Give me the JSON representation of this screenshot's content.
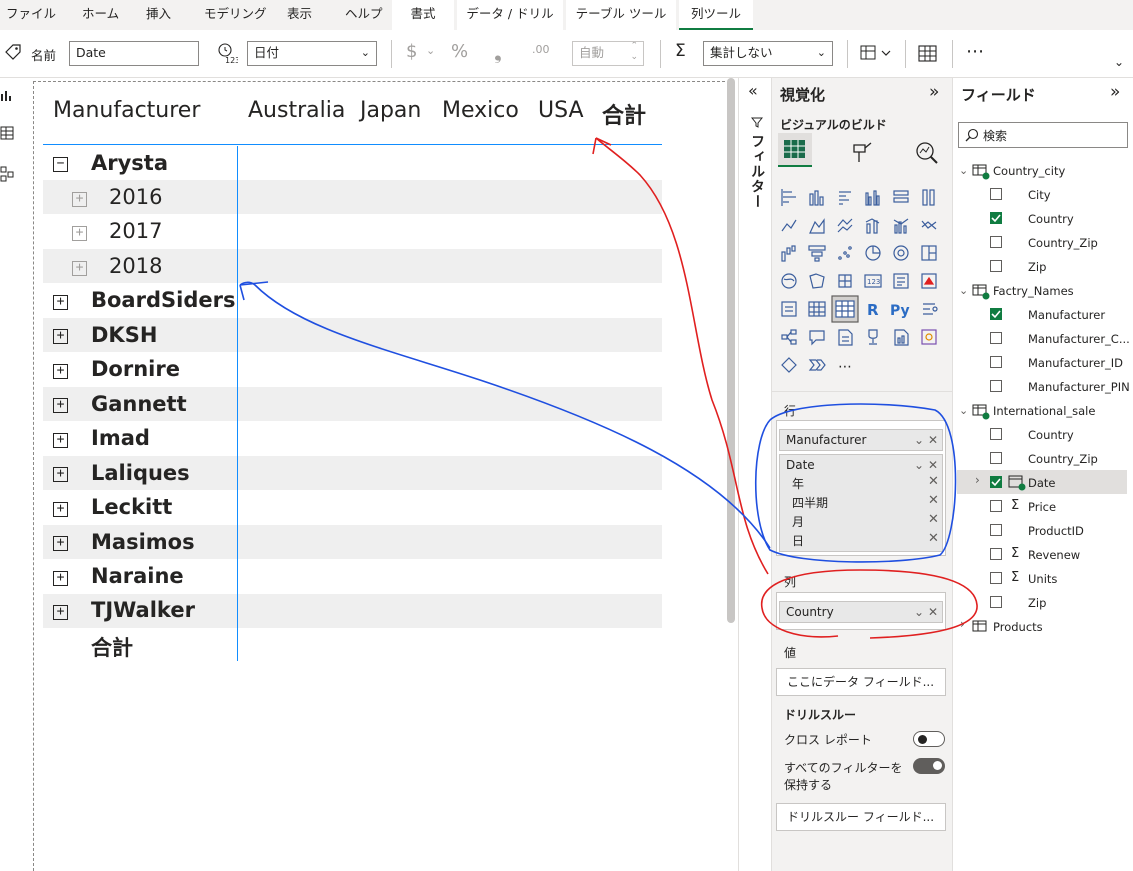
{
  "ribbon": {
    "tabs": [
      "ファイル",
      "ホーム",
      "挿入",
      "モデリング",
      "表示",
      "ヘルプ",
      "書式",
      "データ / ドリル",
      "テーブル ツール",
      "列ツール"
    ],
    "active_tab": "列ツール"
  },
  "toolbar": {
    "name_label": "名前",
    "name_value": "Date",
    "datatype_value": "日付",
    "currency_symbol": "$",
    "percent_symbol": "%",
    "comma_symbol": "❟",
    "decimal_symbol": ".00",
    "auto_value": "自動",
    "sigma": "Σ",
    "summarize_value": "集計しない",
    "more": "⋯"
  },
  "matrix": {
    "row_header": "Manufacturer",
    "columns": [
      "Australia",
      "Japan",
      "Mexico",
      "USA"
    ],
    "total_column": "合計",
    "rows": [
      {
        "label": "Arysta",
        "expander": "−",
        "level": 0
      },
      {
        "label": "2016",
        "expander": "+",
        "level": 1
      },
      {
        "label": "2017",
        "expander": "+",
        "level": 1
      },
      {
        "label": "2018",
        "expander": "+",
        "level": 1
      },
      {
        "label": "BoardSiders",
        "expander": "+",
        "level": 0
      },
      {
        "label": "DKSH",
        "expander": "+",
        "level": 0
      },
      {
        "label": "Dornire",
        "expander": "+",
        "level": 0
      },
      {
        "label": "Gannett",
        "expander": "+",
        "level": 0
      },
      {
        "label": "Imad",
        "expander": "+",
        "level": 0
      },
      {
        "label": "Laliques",
        "expander": "+",
        "level": 0
      },
      {
        "label": "Leckitt",
        "expander": "+",
        "level": 0
      },
      {
        "label": "Masimos",
        "expander": "+",
        "level": 0
      },
      {
        "label": "Naraine",
        "expander": "+",
        "level": 0
      },
      {
        "label": "TJWalker",
        "expander": "+",
        "level": 0
      }
    ],
    "total_row": "合計"
  },
  "filters": {
    "label": "フィルター",
    "collapse_icon": "«"
  },
  "viz": {
    "title": "視覚化",
    "expand_icon": "»",
    "build_label": "ビジュアルのビルド",
    "rows_label": "行",
    "rows_fields": [
      "Manufacturer",
      "Date"
    ],
    "date_hierarchy": [
      "年",
      "四半期",
      "月",
      "日"
    ],
    "columns_label": "列",
    "columns_fields": [
      "Country"
    ],
    "values_label": "値",
    "values_placeholder": "ここにデータ フィールド...",
    "drillthrough_label": "ドリルスルー",
    "cross_report_label": "クロス レポート",
    "keep_filters_label": "すべてのフィルターを保持する",
    "drillthrough_placeholder": "ドリルスルー フィールド...",
    "more_visuals": "⋯",
    "chevron": "⌄",
    "remove": "✕"
  },
  "fields": {
    "title": "フィールド",
    "expand_icon": "»",
    "search_placeholder": "検索",
    "tables": [
      {
        "name": "Country_city",
        "items": [
          {
            "name": "City",
            "checked": false
          },
          {
            "name": "Country",
            "checked": true
          },
          {
            "name": "Country_Zip",
            "checked": false
          },
          {
            "name": "Zip",
            "checked": false
          }
        ]
      },
      {
        "name": "Factry_Names",
        "items": [
          {
            "name": "Manufacturer",
            "checked": true
          },
          {
            "name": "Manufacturer_C...",
            "checked": false
          },
          {
            "name": "Manufacturer_ID",
            "checked": false
          },
          {
            "name": "Manufacturer_PIN",
            "checked": false
          }
        ]
      },
      {
        "name": "International_sale",
        "items": [
          {
            "name": "Country",
            "checked": false
          },
          {
            "name": "Country_Zip",
            "checked": false
          },
          {
            "name": "Date",
            "checked": true
          },
          {
            "name": "Price",
            "checked": false,
            "sigma": true
          },
          {
            "name": "ProductID",
            "checked": false
          },
          {
            "name": "Revenew",
            "checked": false,
            "sigma": true
          },
          {
            "name": "Units",
            "checked": false,
            "sigma": true
          },
          {
            "name": "Zip",
            "checked": false
          }
        ]
      },
      {
        "name": "Products",
        "items": []
      }
    ],
    "sigma": "Σ"
  },
  "colors": {
    "accent_green": "#107c41",
    "matrix_blue": "#118dff",
    "annotation_red": "#e02020",
    "annotation_blue": "#1f4fe0",
    "pane_bg": "#f3f2f1"
  }
}
